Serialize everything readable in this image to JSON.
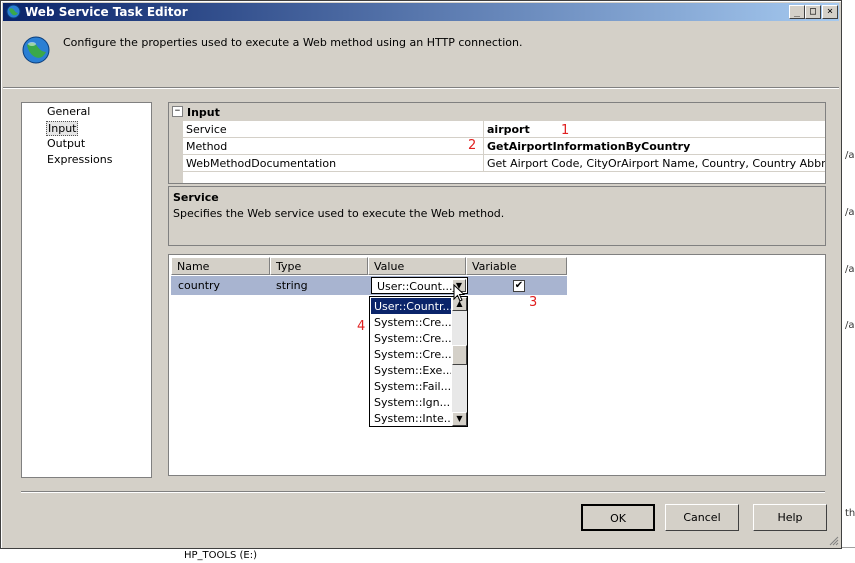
{
  "window": {
    "title": "Web Service Task Editor",
    "min": "_",
    "max": "□",
    "close": "×"
  },
  "header": {
    "text": "Configure the properties used to execute a Web method using an HTTP connection."
  },
  "nav": {
    "items": [
      "General",
      "Input",
      "Output",
      "Expressions"
    ],
    "selected": "Input"
  },
  "properties": {
    "category": "Input",
    "expander": "−",
    "rows": [
      {
        "name": "Service",
        "value": "airport"
      },
      {
        "name": "Method",
        "value": "GetAirportInformationByCountry"
      },
      {
        "name": "WebMethodDocumentation",
        "value": "Get Airport Code, CityOrAirport Name, Country, Country Abbrv, Coun"
      }
    ]
  },
  "description": {
    "title": "Service",
    "text": "Specifies the Web service used to execute the Web method."
  },
  "mapping": {
    "columns": [
      "Name",
      "Type",
      "Value",
      "Variable"
    ],
    "row": {
      "name": "country",
      "type": "string",
      "value": "User::Count...",
      "variable_checked": true
    }
  },
  "dropdown": {
    "items": [
      "User::Countr...",
      "System::Cre...",
      "System::Cre...",
      "System::Cre...",
      "System::Exe...",
      "System::Fail...",
      "System::Ign...",
      "System::Inte..."
    ],
    "selected_index": 0
  },
  "annotations": [
    "1",
    "2",
    "3",
    "4"
  ],
  "buttons": {
    "ok": "OK",
    "cancel": "Cancel",
    "help": "Help"
  },
  "background": {
    "bottom_text": "HP_TOOLS (E:)",
    "right_ticks": [
      "/a",
      "/a",
      "/a",
      "/a",
      "th"
    ]
  },
  "colors": {
    "title_start": "#0a246a",
    "title_end": "#a6caf0",
    "selection": "#0a246a",
    "row_highlight": "#a8b4d0",
    "annotation": "#e02020"
  }
}
